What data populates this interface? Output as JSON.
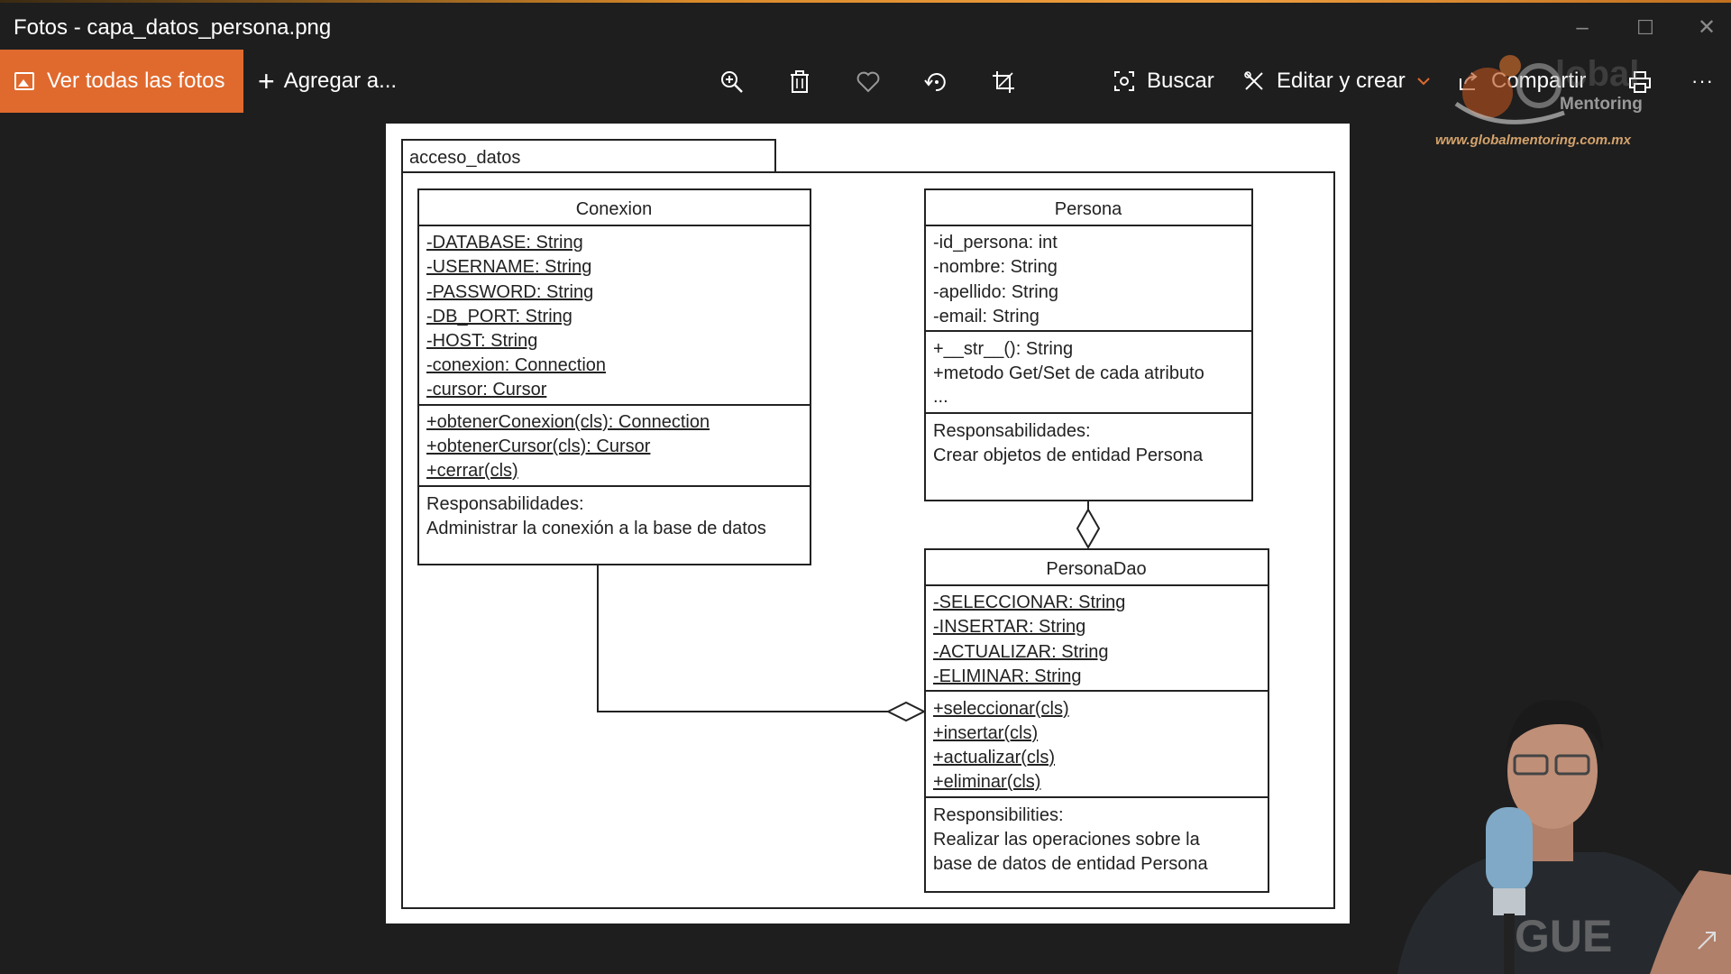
{
  "window": {
    "title": "Fotos - capa_datos_persona.png",
    "controls": [
      "–",
      "☐",
      "✕"
    ]
  },
  "toolbar": {
    "view_all_label": "Ver todas las fotos",
    "add_label": "Agregar a...",
    "search_label": "Buscar",
    "edit_label": "Editar y crear",
    "share_label": "Compartir",
    "more_label": "···",
    "accent_color": "#e06a2e"
  },
  "watermark": {
    "brand": "Mentoring",
    "url": "www.globalmentoring.com.mx"
  },
  "diagram": {
    "package_name": "acceso_datos",
    "classes": {
      "conexion": {
        "name": "Conexion",
        "attributes": [
          "-DATABASE: String",
          "-USERNAME: String",
          "-PASSWORD: String",
          "-DB_PORT: String",
          "-HOST: String",
          "-conexion: Connection",
          "-cursor: Cursor"
        ],
        "methods": [
          "+obtenerConexion(cls): Connection",
          "+obtenerCursor(cls): Cursor",
          "+cerrar(cls)"
        ],
        "resp_title": "Responsabilidades:",
        "resp_lines": [
          "Administrar la conexión a la base de datos"
        ]
      },
      "persona": {
        "name": "Persona",
        "attributes": [
          "-id_persona: int",
          "-nombre: String",
          "-apellido: String",
          "-email: String"
        ],
        "methods": [
          "+__str__(): String",
          "+metodo Get/Set de cada atributo",
          "..."
        ],
        "resp_title": "Responsabilidades:",
        "resp_lines": [
          "Crear objetos de entidad Persona"
        ]
      },
      "personadao": {
        "name": "PersonaDao",
        "attributes": [
          "-SELECCIONAR: String",
          "-INSERTAR: String",
          "-ACTUALIZAR: String",
          "-ELIMINAR: String"
        ],
        "methods": [
          "+seleccionar(cls)",
          "+insertar(cls)",
          "+actualizar(cls)",
          "+eliminar(cls)"
        ],
        "resp_title": "Responsibilities:",
        "resp_lines": [
          "Realizar las operaciones sobre la",
          "base de datos de entidad Persona"
        ]
      }
    }
  }
}
